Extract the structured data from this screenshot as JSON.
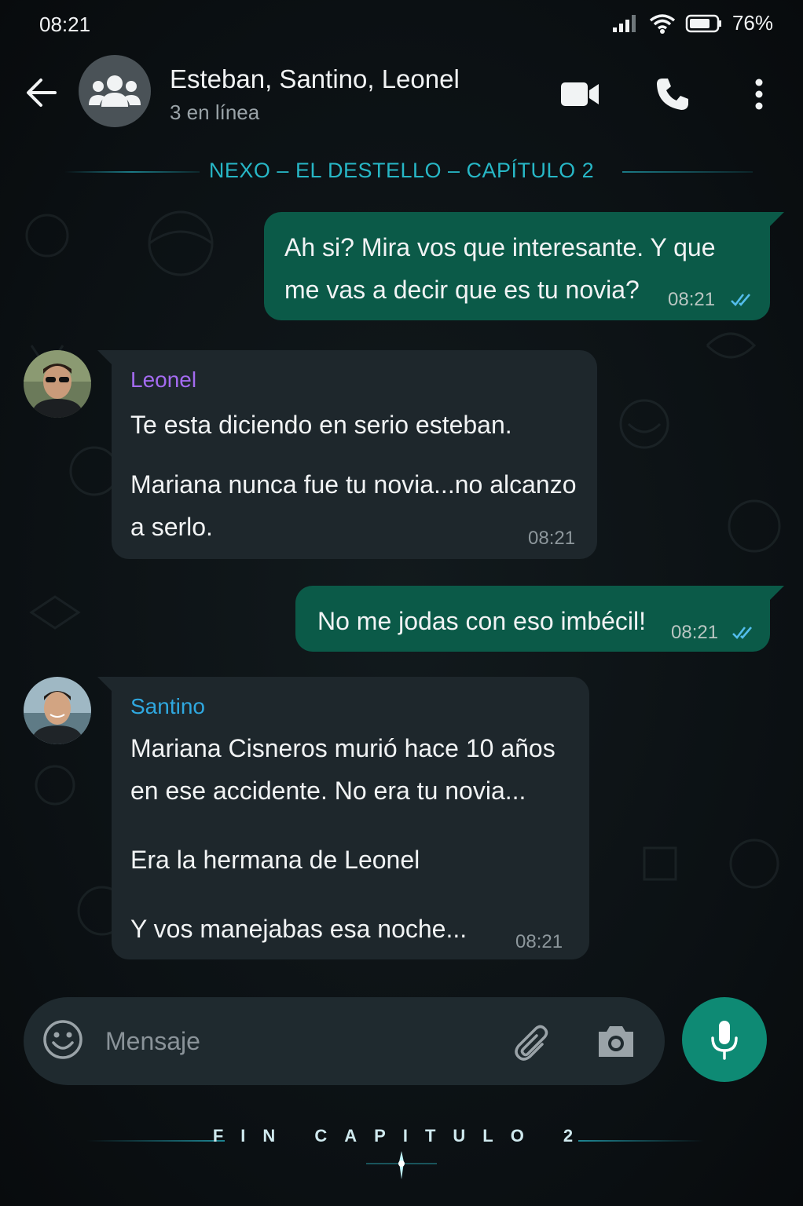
{
  "status": {
    "time": "08:21",
    "battery": "76%"
  },
  "header": {
    "title": "Esteban, Santino, Leonel",
    "subtitle": "3 en línea",
    "icons": [
      "back-arrow-icon",
      "group-icon",
      "video-call-icon",
      "phone-icon",
      "more-vert-icon"
    ]
  },
  "banner": {
    "text": "NEXO – EL DESTELLO – CAPÍTULO 2"
  },
  "messages": [
    {
      "direction": "out",
      "text": "Ah si? Mira vos que interesante. Y que me vas a decir que es tu novia?",
      "time": "08:21"
    },
    {
      "direction": "in",
      "sender": "Leonel",
      "sender_color": "#a46bf0",
      "paragraphs": [
        "Te esta diciendo en serio esteban.",
        "Mariana nunca fue tu novia...no alcanzo a serlo."
      ],
      "time": "08:21"
    },
    {
      "direction": "out",
      "text": "No me jodas con eso imbécil!",
      "time": "08:21"
    },
    {
      "direction": "in",
      "sender": "Santino",
      "sender_color": "#2fa8e0",
      "paragraphs": [
        "Mariana Cisneros murió hace 10 años en ese accidente. No era tu novia...",
        "Era la hermana de Leonel",
        "Y vos manejabas esa noche..."
      ],
      "time": "08:21"
    }
  ],
  "composer": {
    "placeholder": "Mensaje"
  },
  "colors": {
    "outgoing": "#0b5a48",
    "incoming": "#1e272c",
    "accent": "#0e8a74",
    "banner": "#27b7c6",
    "read_ticks": "#53bdeb"
  },
  "ending": {
    "text": "FIN CAPITULO 2"
  }
}
